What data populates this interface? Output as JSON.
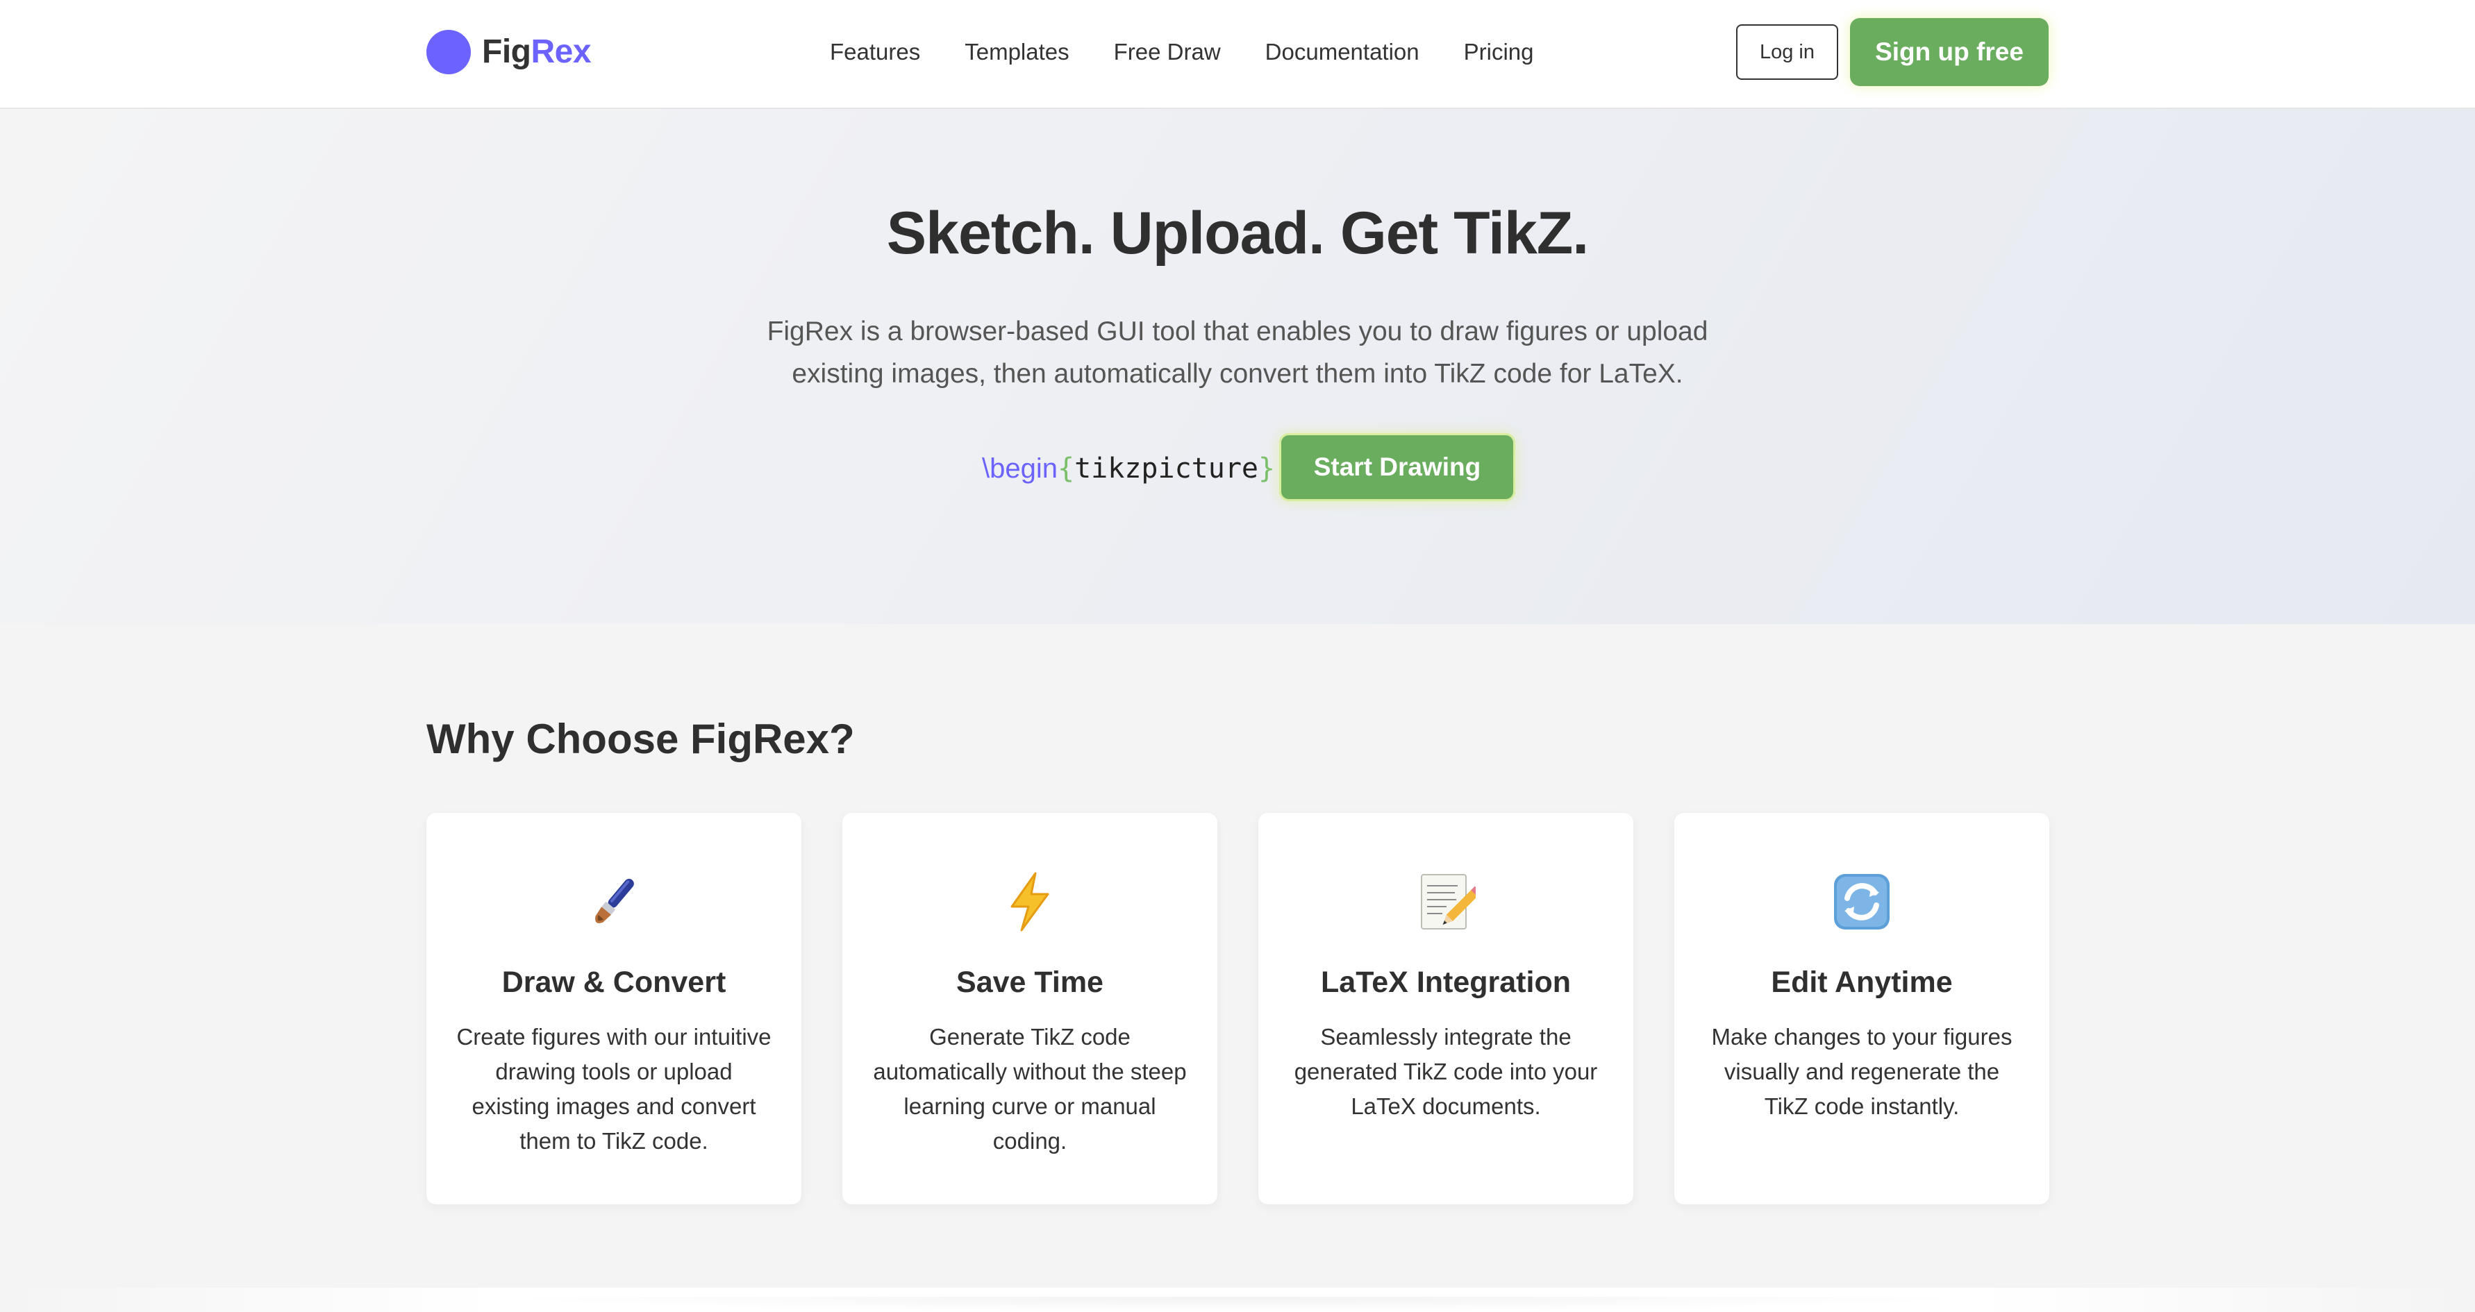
{
  "header": {
    "logo": {
      "part1": "Fig",
      "part2": "Rex",
      "icon": "circle-logo-icon",
      "accent_color": "#6c63ff"
    },
    "nav": [
      "Features",
      "Templates",
      "Free Draw",
      "Documentation",
      "Pricing"
    ],
    "login_label": "Log in",
    "signup_label": "Sign up free"
  },
  "hero": {
    "title": "Sketch. Upload. Get TikZ.",
    "description": "FigRex is a browser-based GUI tool that enables you to draw figures or upload existing images, then automatically convert them into TikZ code for LaTeX.",
    "code": {
      "command": "\\begin",
      "open_brace": "{",
      "environment": "tikzpicture",
      "close_brace": "}"
    },
    "cta_label": "Start Drawing"
  },
  "features": {
    "title": "Why Choose FigRex?",
    "cards": [
      {
        "icon": "paintbrush-icon",
        "title": "Draw & Convert",
        "description": "Create figures with our intuitive drawing tools or upload existing images and convert them to TikZ code."
      },
      {
        "icon": "lightning-icon",
        "title": "Save Time",
        "description": "Generate TikZ code automatically without the steep learning curve or manual coding."
      },
      {
        "icon": "memo-pencil-icon",
        "title": "LaTeX Integration",
        "description": "Seamlessly integrate the generated TikZ code into your LaTeX documents."
      },
      {
        "icon": "refresh-icon",
        "title": "Edit Anytime",
        "description": "Make changes to your figures visually and regenerate the TikZ code instantly."
      }
    ]
  },
  "colors": {
    "primary_green": "#6aad5e",
    "brand_purple": "#6c63ff",
    "text_dark": "#333333"
  }
}
